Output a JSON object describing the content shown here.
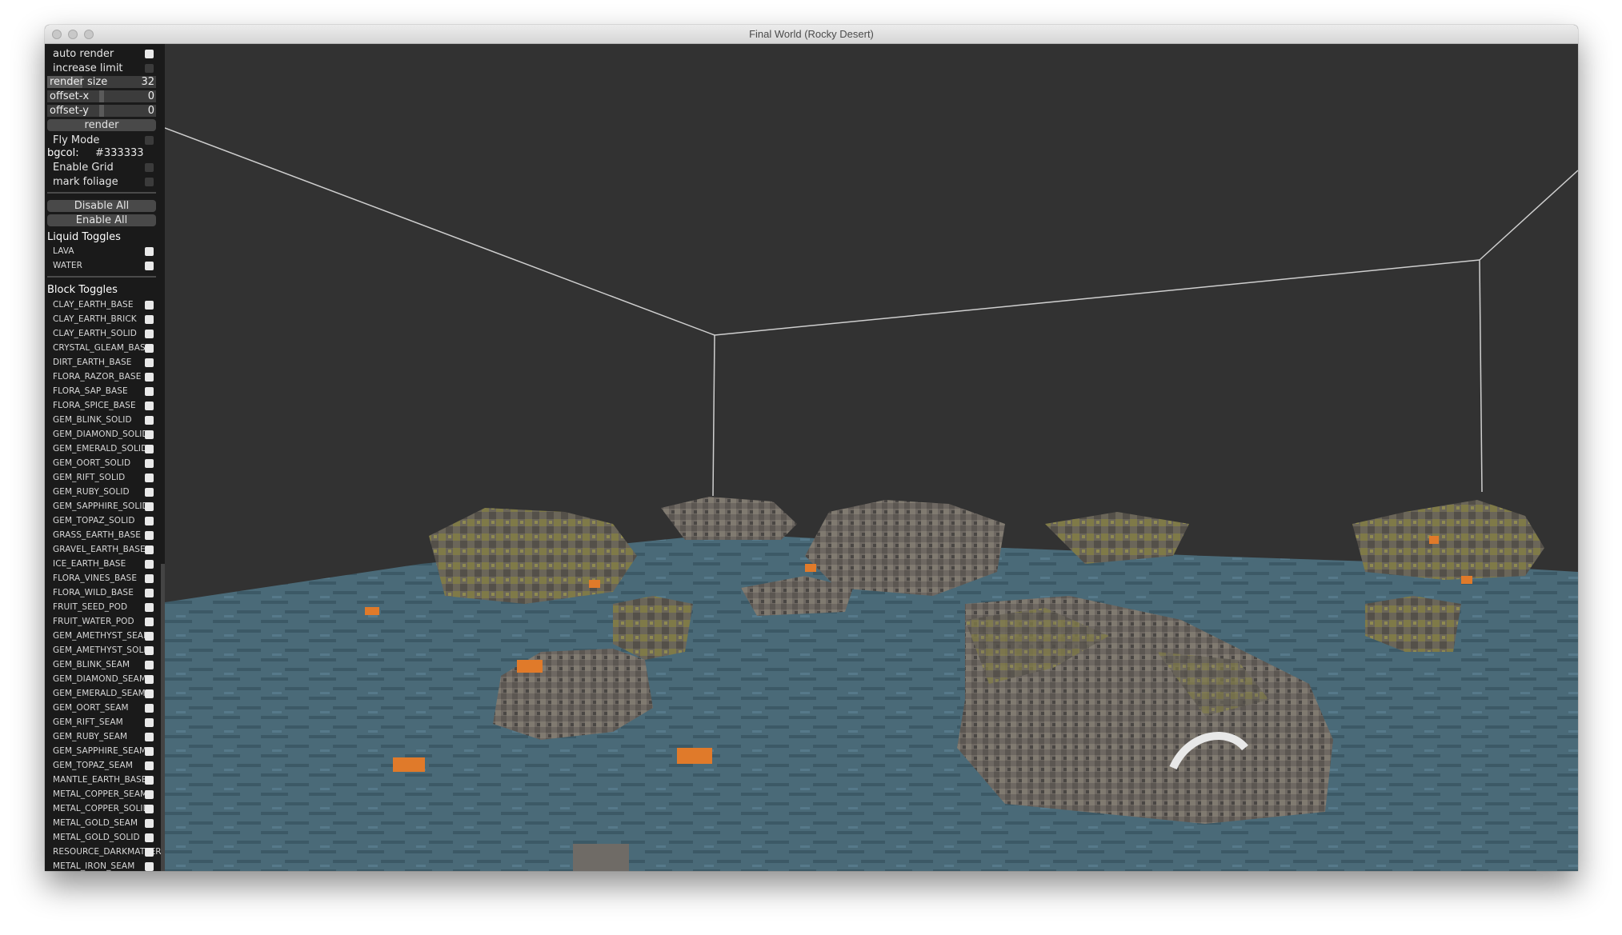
{
  "window": {
    "title": "Final World (Rocky Desert)"
  },
  "controls": {
    "auto_render": {
      "label": "auto render",
      "checked": true
    },
    "increase_limit": {
      "label": "increase limit",
      "checked": false
    },
    "render_size": {
      "label": "render size",
      "value": "32",
      "fraction": 0.32
    },
    "offset_x": {
      "label": "offset-x",
      "value": "0",
      "fraction": 0.5
    },
    "offset_y": {
      "label": "offset-y",
      "value": "0",
      "fraction": 0.5
    },
    "render_button": "render",
    "fly_mode": {
      "label": "Fly Mode",
      "checked": false
    },
    "bgcol": {
      "label": "bgcol:",
      "value": "#333333"
    },
    "enable_grid": {
      "label": "Enable Grid",
      "checked": false
    },
    "mark_foliage": {
      "label": "mark foliage",
      "checked": false
    },
    "disable_all": "Disable All",
    "enable_all": "Enable All"
  },
  "liquid_toggles": {
    "title": "Liquid Toggles",
    "items": [
      {
        "label": "LAVA",
        "checked": true
      },
      {
        "label": "WATER",
        "checked": true
      }
    ]
  },
  "block_toggles": {
    "title": "Block Toggles",
    "items": [
      {
        "label": "CLAY_EARTH_BASE",
        "checked": true
      },
      {
        "label": "CLAY_EARTH_BRICK",
        "checked": true
      },
      {
        "label": "CLAY_EARTH_SOLID",
        "checked": true
      },
      {
        "label": "CRYSTAL_GLEAM_BASE",
        "checked": true
      },
      {
        "label": "DIRT_EARTH_BASE",
        "checked": true
      },
      {
        "label": "FLORA_RAZOR_BASE",
        "checked": true
      },
      {
        "label": "FLORA_SAP_BASE",
        "checked": true
      },
      {
        "label": "FLORA_SPICE_BASE",
        "checked": true
      },
      {
        "label": "GEM_BLINK_SOLID",
        "checked": true
      },
      {
        "label": "GEM_DIAMOND_SOLID",
        "checked": true
      },
      {
        "label": "GEM_EMERALD_SOLID",
        "checked": true
      },
      {
        "label": "GEM_OORT_SOLID",
        "checked": true
      },
      {
        "label": "GEM_RIFT_SOLID",
        "checked": true
      },
      {
        "label": "GEM_RUBY_SOLID",
        "checked": true
      },
      {
        "label": "GEM_SAPPHIRE_SOLID",
        "checked": true
      },
      {
        "label": "GEM_TOPAZ_SOLID",
        "checked": true
      },
      {
        "label": "GRASS_EARTH_BASE",
        "checked": true
      },
      {
        "label": "GRAVEL_EARTH_BASE",
        "checked": true
      },
      {
        "label": "ICE_EARTH_BASE",
        "checked": true
      },
      {
        "label": "FLORA_VINES_BASE",
        "checked": true
      },
      {
        "label": "FLORA_WILD_BASE",
        "checked": true
      },
      {
        "label": "FRUIT_SEED_POD",
        "checked": true
      },
      {
        "label": "FRUIT_WATER_POD",
        "checked": true
      },
      {
        "label": "GEM_AMETHYST_SEAM",
        "checked": true
      },
      {
        "label": "GEM_AMETHYST_SOLID",
        "checked": true
      },
      {
        "label": "GEM_BLINK_SEAM",
        "checked": true
      },
      {
        "label": "GEM_DIAMOND_SEAM",
        "checked": true
      },
      {
        "label": "GEM_EMERALD_SEAM",
        "checked": true
      },
      {
        "label": "GEM_OORT_SEAM",
        "checked": true
      },
      {
        "label": "GEM_RIFT_SEAM",
        "checked": true
      },
      {
        "label": "GEM_RUBY_SEAM",
        "checked": true
      },
      {
        "label": "GEM_SAPPHIRE_SEAM",
        "checked": true
      },
      {
        "label": "GEM_TOPAZ_SEAM",
        "checked": true
      },
      {
        "label": "MANTLE_EARTH_BASE",
        "checked": true
      },
      {
        "label": "METAL_COPPER_SEAM",
        "checked": true
      },
      {
        "label": "METAL_COPPER_SOLID",
        "checked": true
      },
      {
        "label": "METAL_GOLD_SEAM",
        "checked": true
      },
      {
        "label": "METAL_GOLD_SOLID",
        "checked": true
      },
      {
        "label": "RESOURCE_DARKMATTER_S",
        "checked": true
      },
      {
        "label": "METAL_IRON_SEAM",
        "checked": true
      }
    ]
  },
  "colors": {
    "background": "#333333",
    "terrain": "#4a6a78",
    "rock": "#6e6862",
    "moss": "#7f7a48",
    "ore": "#e07a2a"
  }
}
